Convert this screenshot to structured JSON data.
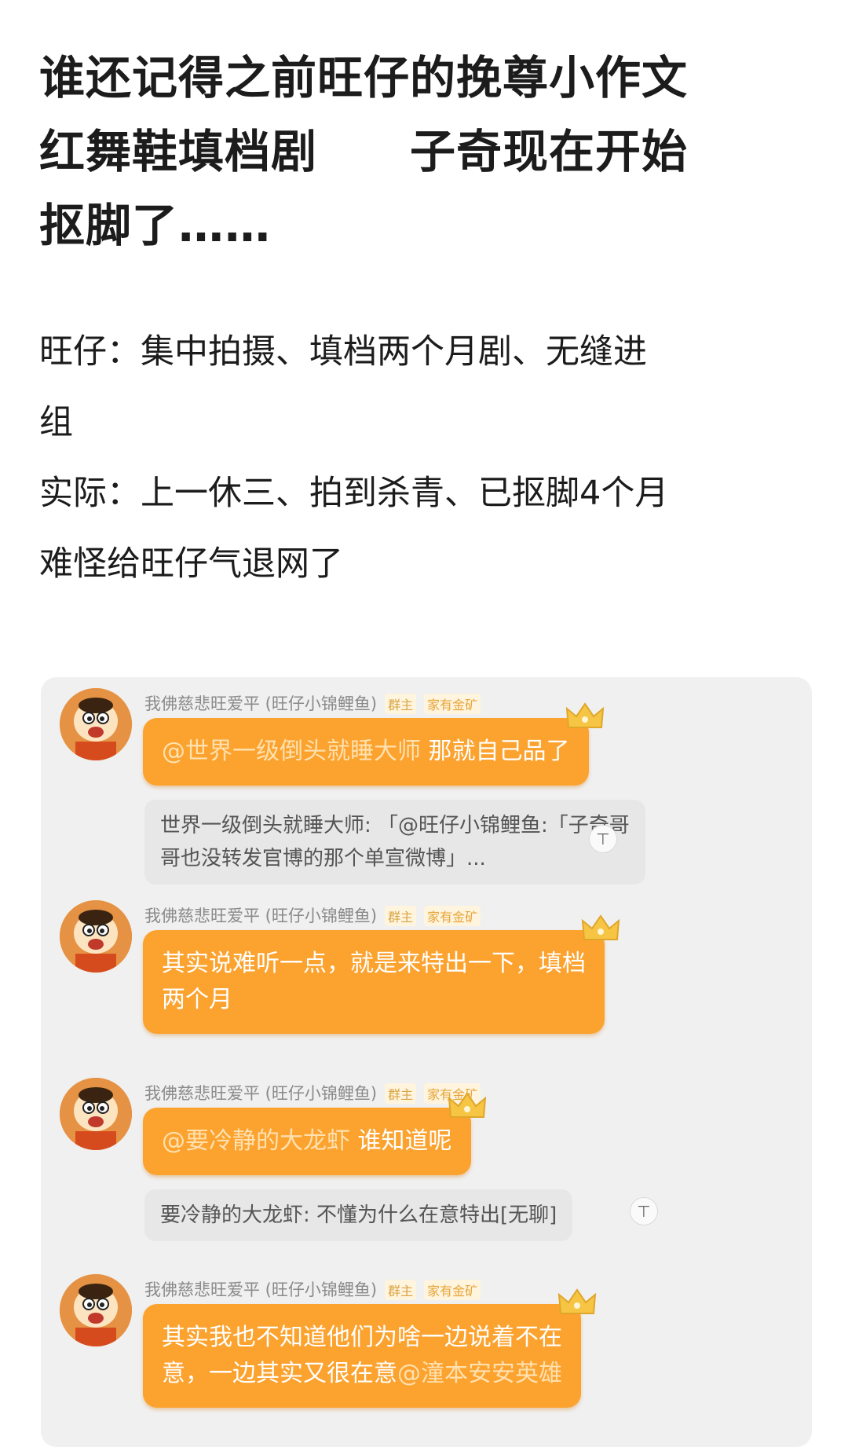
{
  "post": {
    "title_lines": [
      "谁还记得之前旺仔的挽尊小作文",
      "红舞鞋填档剧",
      "子奇现在开始",
      "抠脚了……"
    ],
    "body_lines": [
      "旺仔：集中拍摄、填档两个月剧、无缝进",
      "组",
      "实际：上一休三、拍到杀青、已抠脚4个月",
      "难怪给旺仔气退网了"
    ]
  },
  "chat": {
    "sender_name": "我佛慈悲旺爱平 (旺仔小锦鲤鱼)",
    "badge_owner": "群主",
    "badge_gold": "家有金矿",
    "fold_icon": "fold-icon",
    "messages": [
      {
        "mention": "@世界一级倒头就睡大师",
        "text": " 那就自己品了",
        "quote_line1": "世界一级倒头就睡大师: 「@旺仔小锦鲤鱼:「子奇哥",
        "quote_line2": "哥也没转发官博的那个单宣微博」..."
      },
      {
        "line1": "其实说难听一点，就是来特出一下，填档",
        "line2": "两个月"
      },
      {
        "mention": "@要冷静的大龙虾",
        "text": " 谁知道呢",
        "quote_line1": "要冷静的大龙虾: 不懂为什么在意特出[无聊]"
      },
      {
        "line1": "其实我也不知道他们为啥一边说着不在",
        "line2": "意，一边其实又很在意",
        "mention": "@潼本安安英雄"
      }
    ]
  }
}
